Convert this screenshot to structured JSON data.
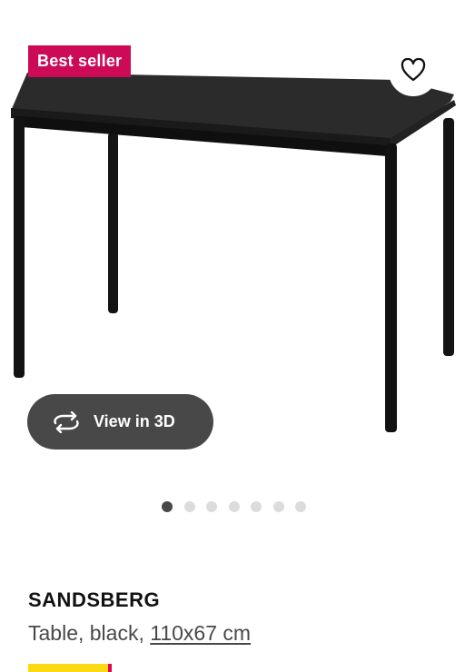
{
  "badge": {
    "label": "Best seller",
    "color": "#cc0a56"
  },
  "favorite": {
    "icon": "heart-outline-icon"
  },
  "view3d": {
    "label": "View in 3D",
    "icon": "rotate-3d-icon"
  },
  "carousel": {
    "total": 7,
    "active_index": 0
  },
  "product": {
    "name": "SANDSBERG",
    "description_prefix": "Table, black, ",
    "dimensions": "110x67 cm"
  },
  "price_tag": {
    "colors": [
      "#fbd914",
      "#e00751"
    ]
  }
}
